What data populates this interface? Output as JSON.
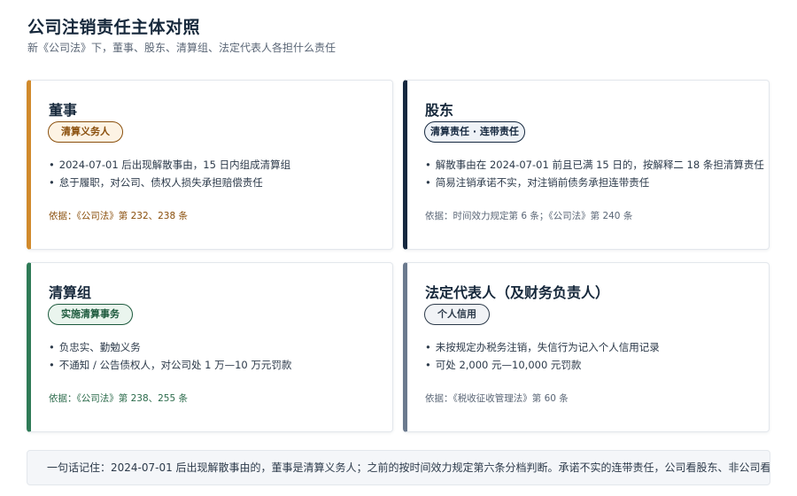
{
  "header": {
    "title": "公司注销责任主体对照",
    "subtitle": "新《公司法》下，董事、股东、清算组、法定代表人各担什么责任"
  },
  "cards": [
    {
      "title": "董事",
      "badge": "清算义务人",
      "bullets": [
        "2024-07-01 后出现解散事由，15 日内组成清算组",
        "怠于履职，对公司、债权人损失承担赔偿责任"
      ],
      "basis": "依据：《公司法》第 232、238 条",
      "colors": {
        "accent": "#d18a2c",
        "badge_bg": "#fdf3e4",
        "badge_text": "#8a4f0c",
        "basis": "#8a4f0c"
      }
    },
    {
      "title": "股东",
      "badge": "清算责任 · 连带责任",
      "bullets": [
        "解散事由在 2024-07-01 前且已满 15 日的，按解释二 18 条担清算责任",
        "简易注销承诺不实，对注销前债务承担连带责任"
      ],
      "basis": "依据：时间效力规定第 6 条；《公司法》第 240 条",
      "colors": {
        "accent": "#15283f",
        "badge_bg": "#eef2f7",
        "badge_text": "#15283f",
        "basis": "#5a6676"
      }
    },
    {
      "title": "清算组",
      "badge": "实施清算事务",
      "bullets": [
        "负忠实、勤勉义务",
        "不通知 / 公告债权人，对公司处 1 万—10 万元罚款"
      ],
      "basis": "依据：《公司法》第 238、255 条",
      "colors": {
        "accent": "#2f7b57",
        "badge_bg": "#eaf5ee",
        "badge_text": "#1d5a3d",
        "basis": "#2a6a4a"
      }
    },
    {
      "title": "法定代表人（及财务负责人）",
      "badge": "个人信用",
      "bullets": [
        "未按规定办税务注销，失信行为记入个人信用记录",
        "可处 2,000 元—10,000 元罚款"
      ],
      "basis": "依据：《税收征收管理法》第 60 条",
      "colors": {
        "accent": "#6b7a8e",
        "badge_bg": "#f1f3f6",
        "badge_text": "#2c3a4a",
        "basis": "#5a6676"
      }
    }
  ],
  "footer": {
    "note": "一句话记住：2024-07-01 后出现解散事由的，董事是清算义务人；之前的按时间效力规定第六条分档判断。承诺不实的连带责任，公司看股东、非公司看"
  }
}
